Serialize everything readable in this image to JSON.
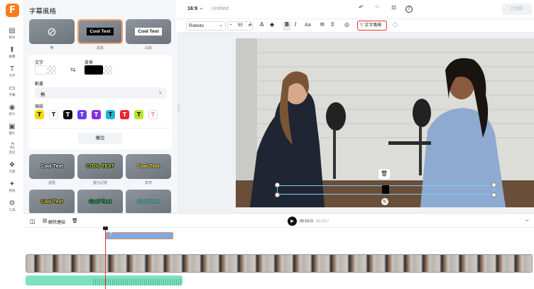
{
  "app": {
    "logo_letter": "F",
    "brand_color": "#ff7a1a"
  },
  "rail": [
    {
      "icon": "▤",
      "icon_name": "template-icon",
      "label": "範本"
    },
    {
      "icon": "⬆",
      "icon_name": "upload-icon",
      "label": "媒體"
    },
    {
      "icon": "T",
      "icon_name": "text-icon",
      "label": "文字"
    },
    {
      "icon": "▭",
      "icon_name": "caption-icon",
      "label": "字幕"
    },
    {
      "icon": "◉",
      "icon_name": "video-icon",
      "label": "影片"
    },
    {
      "icon": "▣",
      "icon_name": "image-icon",
      "label": "圖片"
    },
    {
      "icon": "♫",
      "icon_name": "audio-icon",
      "label": "音訊"
    },
    {
      "icon": "❖",
      "icon_name": "elements-icon",
      "label": "元素"
    },
    {
      "icon": "✦",
      "icon_name": "effects-icon",
      "label": "特效"
    },
    {
      "icon": "⚙",
      "icon_name": "tools-icon",
      "label": "工具"
    }
  ],
  "panel": {
    "title": "字幕風格",
    "top_styles": [
      {
        "text": "⊘",
        "label": "無"
      },
      {
        "text": "Cool Text",
        "label": "黑底"
      },
      {
        "text": "Cool Text",
        "label": "白底"
      }
    ],
    "text_label": "文字",
    "bg_label": "背景",
    "swap_icon": "⇆",
    "animation_label": "動畫",
    "animation_value": "無",
    "animation_chevron": "›",
    "preset_label": "預設",
    "presets": [
      {
        "letter": "T",
        "bg": "#f5d90a",
        "fg": "#111"
      },
      {
        "letter": "T",
        "bg": "#ffffff",
        "fg": "#111"
      },
      {
        "letter": "T",
        "bg": "#111111",
        "fg": "#fff"
      },
      {
        "letter": "T",
        "bg": "#6a3cf0",
        "fg": "#fff"
      },
      {
        "letter": "T",
        "bg": "#8a2be2",
        "fg": "#fff"
      },
      {
        "letter": "T",
        "bg": "#1fb6d6",
        "fg": "#111"
      },
      {
        "letter": "T",
        "bg": "#e8262b",
        "fg": "#fff"
      },
      {
        "letter": "T",
        "bg": "#b8e62a",
        "fg": "#111"
      },
      {
        "letter": "T",
        "bg": "#ffffff",
        "fg": "#f08ab8"
      }
    ],
    "reset_label": "複位",
    "styles": [
      {
        "text": "Cool Text",
        "label": "邊框",
        "color": "#ffffff",
        "stroke": "#111"
      },
      {
        "text": "COOL TEXT",
        "label": "螢光記號",
        "color": "#b8f23a",
        "stroke": "#111"
      },
      {
        "text": "Cool Text",
        "label": "高亮",
        "color": "#f5e23a",
        "stroke": "#333"
      },
      {
        "text": "Cool Text",
        "label": "",
        "color": "#f5e23a",
        "stroke": "#111"
      },
      {
        "text": "Cool Text",
        "label": "",
        "color": "#2fe07a",
        "stroke": "#111"
      },
      {
        "text": "Cool Text",
        "label": "",
        "color": "#2fd4b0",
        "stroke": "#555"
      }
    ]
  },
  "topbar": {
    "ratio": "16:9",
    "ratio_chevron": "⌄",
    "title": "Untitled",
    "undo_icon": "↶",
    "redo_icon": "↷",
    "screenshot_icon": "⊡",
    "help_icon": "?",
    "export_label": "已儲存"
  },
  "format": {
    "font": "Roboto",
    "font_chevron": "⌄",
    "minus": "−",
    "size": "50",
    "size_chevron": "⌄",
    "plus": "+",
    "color_icon": "A",
    "highlight_icon": "◆",
    "bold": "B",
    "italic": "I",
    "case": "Aa",
    "align_icon": "≡",
    "spacing_icon": "⇕",
    "layers_icon": "◎",
    "style_button": "文字風格",
    "style_icon": "▽",
    "more_icon": "◌"
  },
  "canvas": {
    "delete_icon": "🗑",
    "rotate_icon": "↻"
  },
  "timeline": {
    "split_icon": "◫",
    "unlink_label": "解除連結",
    "unlink_icon": "⛓",
    "trash_icon": "🗑",
    "play_icon": "▶",
    "current": "00:02.0",
    "separator": "/",
    "total": "00:15.7",
    "caption_clip": "T",
    "minus_icon": "−"
  }
}
